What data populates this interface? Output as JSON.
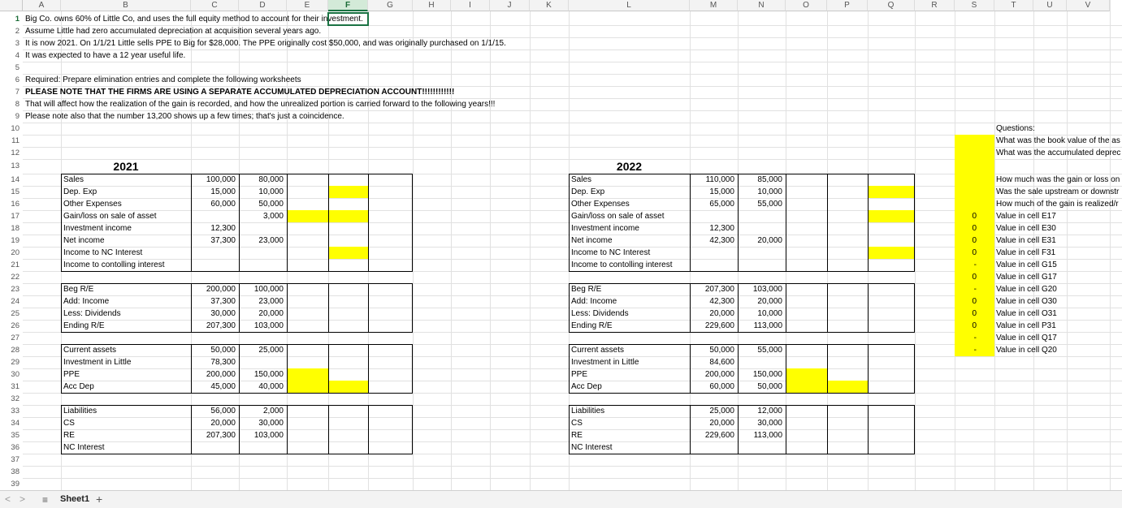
{
  "columns": [
    "A",
    "B",
    "C",
    "D",
    "E",
    "F",
    "G",
    "H",
    "I",
    "J",
    "K",
    "L",
    "M",
    "N",
    "O",
    "P",
    "Q",
    "R",
    "S",
    "T",
    "U",
    "V"
  ],
  "selected_column": "F",
  "selected_row": "1",
  "rows": [
    "1",
    "2",
    "3",
    "4",
    "5",
    "6",
    "7",
    "8",
    "9",
    "10",
    "11",
    "12",
    "13",
    "14",
    "15",
    "16",
    "17",
    "18",
    "19",
    "20",
    "21",
    "22",
    "23",
    "24",
    "25",
    "26",
    "27",
    "28",
    "29",
    "30",
    "31",
    "32",
    "33",
    "34",
    "35",
    "36",
    "37",
    "38",
    "39"
  ],
  "notes": [
    {
      "row": 1,
      "text": "Big Co. owns 60% of Little Co, and uses the full equity method to account for their investment.",
      "bold": false
    },
    {
      "row": 2,
      "text": "Assume Little had zero accumulated depreciation at acquisition several years ago.",
      "bold": false
    },
    {
      "row": 3,
      "text": "It is now 2021.  On 1/1/21 Little sells PPE to Big for $28,000.  The PPE originally cost $50,000, and was originally purchased on 1/1/15.",
      "bold": false
    },
    {
      "row": 4,
      "text": "It was expected to have a 12 year useful life.",
      "bold": false
    },
    {
      "row": 6,
      "text": "Required: Prepare elimination entries and complete the following worksheets",
      "bold": false
    },
    {
      "row": 7,
      "text": "PLEASE NOTE THAT THE FIRMS ARE USING A SEPARATE ACCUMULATED DEPRECIATION ACCOUNT!!!!!!!!!!!!",
      "bold": true
    },
    {
      "row": 8,
      "text": "That will affect how the realization of the gain is recorded, and how the unrealized portion is carried forward to the following years!!!",
      "bold": false
    },
    {
      "row": 9,
      "text": "Please note also that the number 13,200 shows up a few times; that's just a coincidence.",
      "bold": false
    }
  ],
  "ws2021": {
    "year": "2021",
    "income": [
      {
        "label": "Sales",
        "c": "100,000",
        "d": "80,000"
      },
      {
        "label": "Dep. Exp",
        "c": "15,000",
        "d": "10,000"
      },
      {
        "label": "Other Expenses",
        "c": "60,000",
        "d": "50,000"
      },
      {
        "label": "Gain/loss on sale of asset",
        "c": "",
        "d": "3,000"
      },
      {
        "label": "Investment income",
        "c": "12,300",
        "d": ""
      },
      {
        "label": "Net income",
        "c": "37,300",
        "d": "23,000"
      },
      {
        "label": "Income to NC Interest",
        "c": "",
        "d": ""
      },
      {
        "label": "Income to contolling interest",
        "c": "",
        "d": ""
      }
    ],
    "re": [
      {
        "label": "Beg R/E",
        "c": "200,000",
        "d": "100,000"
      },
      {
        "label": "Add: Income",
        "c": "37,300",
        "d": "23,000"
      },
      {
        "label": "Less: Dividends",
        "c": "30,000",
        "d": "20,000"
      },
      {
        "label": "Ending R/E",
        "c": "207,300",
        "d": "103,000"
      }
    ],
    "assets": [
      {
        "label": "Current assets",
        "c": "50,000",
        "d": "25,000"
      },
      {
        "label": "Investment in Little",
        "c": "78,300",
        "d": ""
      },
      {
        "label": "PPE",
        "c": "200,000",
        "d": "150,000"
      },
      {
        "label": "Acc Dep",
        "c": "45,000",
        "d": "40,000"
      }
    ],
    "liab": [
      {
        "label": "Liabilities",
        "c": "56,000",
        "d": "2,000"
      },
      {
        "label": "CS",
        "c": "20,000",
        "d": "30,000"
      },
      {
        "label": "RE",
        "c": "207,300",
        "d": "103,000"
      },
      {
        "label": "NC Interest",
        "c": "",
        "d": ""
      }
    ]
  },
  "ws2022": {
    "year": "2022",
    "income": [
      {
        "label": "Sales",
        "c": "110,000",
        "d": "85,000"
      },
      {
        "label": "Dep. Exp",
        "c": "15,000",
        "d": "10,000"
      },
      {
        "label": "Other Expenses",
        "c": "65,000",
        "d": "55,000"
      },
      {
        "label": "Gain/loss on sale of asset",
        "c": "",
        "d": ""
      },
      {
        "label": "Investment income",
        "c": "12,300",
        "d": ""
      },
      {
        "label": "Net income",
        "c": "42,300",
        "d": "20,000"
      },
      {
        "label": "Income to NC Interest",
        "c": "",
        "d": ""
      },
      {
        "label": "Income to contolling interest",
        "c": "",
        "d": ""
      }
    ],
    "re": [
      {
        "label": "Beg R/E",
        "c": "207,300",
        "d": "103,000"
      },
      {
        "label": "Add: Income",
        "c": "42,300",
        "d": "20,000"
      },
      {
        "label": "Less: Dividends",
        "c": "20,000",
        "d": "10,000"
      },
      {
        "label": "Ending R/E",
        "c": "229,600",
        "d": "113,000"
      }
    ],
    "assets": [
      {
        "label": "Current assets",
        "c": "50,000",
        "d": "55,000"
      },
      {
        "label": "Investment in Little",
        "c": "84,600",
        "d": ""
      },
      {
        "label": "PPE",
        "c": "200,000",
        "d": "150,000"
      },
      {
        "label": "Acc Dep",
        "c": "60,000",
        "d": "50,000"
      }
    ],
    "liab": [
      {
        "label": "Liabilities",
        "c": "25,000",
        "d": "12,000"
      },
      {
        "label": "CS",
        "c": "20,000",
        "d": "30,000"
      },
      {
        "label": "RE",
        "c": "229,600",
        "d": "113,000"
      },
      {
        "label": "NC Interest",
        "c": "",
        "d": ""
      }
    ]
  },
  "questions": {
    "header": "Questions:",
    "items": [
      {
        "row": 11,
        "s": "",
        "text": "What was the book value of the as"
      },
      {
        "row": 12,
        "s": "",
        "text": "What was the accumulated deprec"
      },
      {
        "row": 14,
        "s": "",
        "text": "How much was the gain or loss on"
      },
      {
        "row": 15,
        "s": "",
        "text": "Was the sale upstream or downstr"
      },
      {
        "row": 16,
        "s": "",
        "text": "How much of the gain is realized/r"
      },
      {
        "row": 17,
        "s": "0",
        "text": "Value in cell E17"
      },
      {
        "row": 18,
        "s": "0",
        "text": "Value in cell E30"
      },
      {
        "row": 19,
        "s": "0",
        "text": "Value in cell E31"
      },
      {
        "row": 20,
        "s": "0",
        "text": "Value in cell F31"
      },
      {
        "row": 21,
        "s": "-",
        "text": "Value in cell G15"
      },
      {
        "row": 22,
        "s": "0",
        "text": "Value in cell G17"
      },
      {
        "row": 23,
        "s": "-",
        "text": "Value in cell G20"
      },
      {
        "row": 24,
        "s": "0",
        "text": "Value in cell O30"
      },
      {
        "row": 25,
        "s": "0",
        "text": "Value in cell O31"
      },
      {
        "row": 26,
        "s": "0",
        "text": "Value in cell P31"
      },
      {
        "row": 27,
        "s": "-",
        "text": "Value in cell Q17"
      },
      {
        "row": 28,
        "s": "-",
        "text": "Value in cell Q20"
      }
    ]
  },
  "highlight_color": "#ffff00",
  "accent_color": "#1a7343",
  "sheet_tab": "Sheet1",
  "add_sheet": "+",
  "menu_icon": "≡",
  "nav_prev": "<",
  "nav_next": ">"
}
